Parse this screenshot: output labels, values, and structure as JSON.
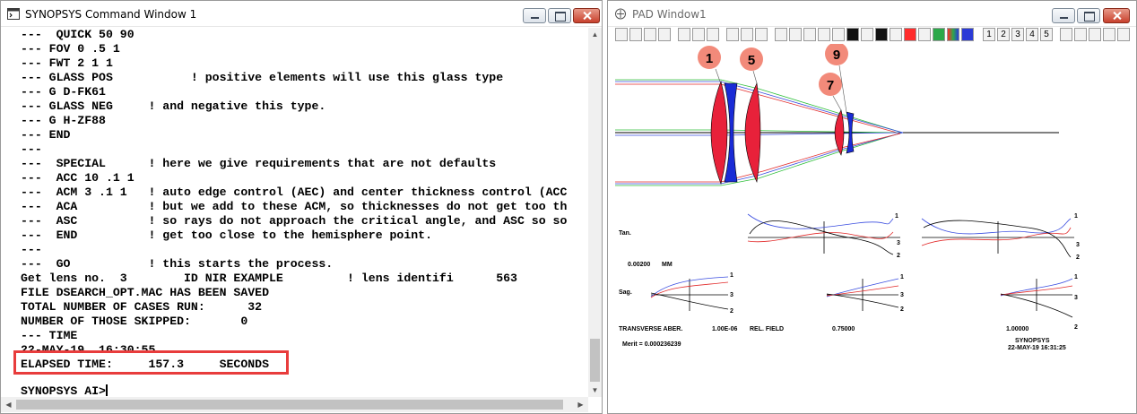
{
  "command_window": {
    "title": "SYNOPSYS Command Window 1",
    "lines": [
      "---  QUICK 50 90",
      "--- FOV 0 .5 1",
      "--- FWT 2 1 1",
      "--- GLASS POS           ! positive elements will use this glass type",
      "--- G D-FK61",
      "--- GLASS NEG     ! and negative this type.",
      "--- G H-ZF88",
      "--- END",
      "---",
      "---  SPECIAL      ! here we give requirements that are not defaults",
      "---  ACC 10 .1 1",
      "---  ACM 3 .1 1   ! auto edge control (AEC) and center thickness control (ACC",
      "---  ACA          ! but we add to these ACM, so thicknesses do not get too th",
      "---  ASC          ! so rays do not approach the critical angle, and ASC so so",
      "---  END          ! get too close to the hemisphere point.",
      "---",
      "---  GO           ! this starts the process.",
      "Get lens no.  3        ID NIR EXAMPLE         ! lens identifi      563",
      "FILE DSEARCH_OPT.MAC HAS BEEN SAVED",
      "TOTAL NUMBER OF CASES RUN:      32",
      "NUMBER OF THOSE SKIPPED:       0",
      "--- TIME",
      "22-MAY-19  16:30:55",
      "ELAPSED TIME:     157.3     SECONDS",
      "",
      "SYNOPSYS AI>"
    ]
  },
  "pad_window": {
    "title": "PAD Window1",
    "toolbar_numbers": [
      "1",
      "2",
      "3",
      "4",
      "5"
    ],
    "element_labels": [
      "1",
      "5",
      "7",
      "9"
    ],
    "plot": {
      "tan_label": "Tan.",
      "sag_label": "Sag.",
      "scale": "0.00200",
      "scale_unit": "MM",
      "footer_left": "TRANSVERSE ABER.",
      "footer_wave": "1.00E-06",
      "footer_rel": "REL. FIELD",
      "field_mid": "0.75000",
      "field_full": "1.00000",
      "merit": "Merit = 0.000236239",
      "brand": "SYNOPSYS",
      "date": "22-MAY-19  16:31:25",
      "curve_labels": [
        "1",
        "3",
        "2"
      ]
    }
  },
  "colors": {
    "positive_element": "#e8213a",
    "negative_element": "#1a2bd6",
    "ray_green": "#2fbf3a",
    "ray_blue": "#3b4ee0",
    "ray_red": "#e22a2a",
    "highlight_box": "#e83c3c",
    "label_circle": "#f28a7a"
  }
}
